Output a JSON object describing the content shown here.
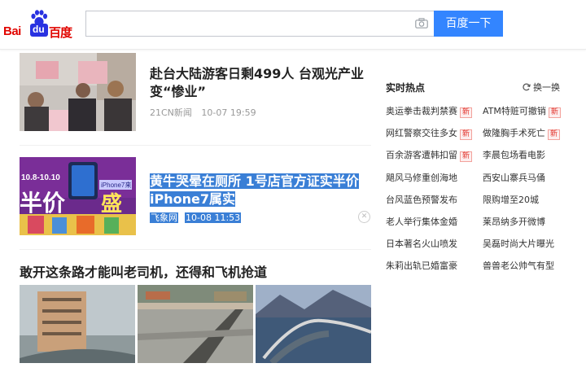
{
  "header": {
    "logo": {
      "latin_prefix": "Bai",
      "paw_text": "du",
      "chinese": "百度"
    },
    "search": {
      "value": "",
      "placeholder": ""
    },
    "search_button": "百度一下",
    "icons": {
      "camera": "camera-icon",
      "paw": "paw-icon"
    },
    "colors": {
      "brand_red": "#e10601",
      "brand_blue": "#2932e1",
      "button_blue": "#3385ff"
    }
  },
  "feed": {
    "items": [
      {
        "title": "赴台大陆游客日剩499人 台观光产业变“惨业”",
        "source": "21CN新闻",
        "time": "10-07 19:59",
        "highlighted": false
      },
      {
        "title": "黄牛哭晕在厕所 1号店官方证实半价iPhone7属实",
        "source": "飞象网",
        "time": "10-08 11:53",
        "highlighted": true,
        "ad_text": {
          "date_range": "10.8-10.10",
          "phone": "iPhone7来",
          "half_price": "半价",
          "promo": "盛"
        }
      }
    ],
    "gallery_title": "敢开这条路才能叫老司机，还得和飞机抢道"
  },
  "hot": {
    "title": "实时热点",
    "refresh_label": "换一换",
    "badge_new": "新",
    "items": [
      {
        "text": "奥运拳击裁判禁赛",
        "new": true
      },
      {
        "text": "ATM特赃可撤销",
        "new": true
      },
      {
        "text": "网红警察交往多女",
        "new": true
      },
      {
        "text": "做隆胸手术死亡",
        "new": true
      },
      {
        "text": "百余游客遭韩扣留",
        "new": true
      },
      {
        "text": "李晨包场看电影",
        "new": false
      },
      {
        "text": "飓风马修重创海地",
        "new": false
      },
      {
        "text": "西安山寨兵马俑",
        "new": false
      },
      {
        "text": "台风蓝色预警发布",
        "new": false
      },
      {
        "text": "限购增至20城",
        "new": false
      },
      {
        "text": "老人举行集体金婚",
        "new": false
      },
      {
        "text": "莱昂纳多开微博",
        "new": false
      },
      {
        "text": "日本著名火山喷发",
        "new": false
      },
      {
        "text": "吴磊时尚大片曝光",
        "new": false
      },
      {
        "text": "朱莉出轨已婚富豪",
        "new": false
      },
      {
        "text": "兽兽老公帅气有型",
        "new": false
      }
    ]
  }
}
